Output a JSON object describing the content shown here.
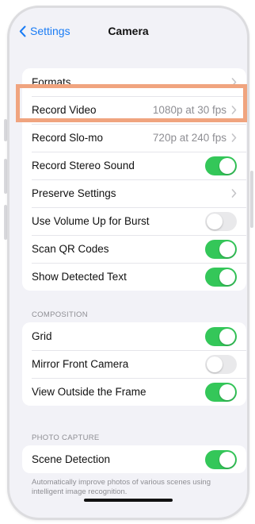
{
  "nav": {
    "back_label": "Settings",
    "title": "Camera"
  },
  "group1": {
    "rows": [
      {
        "label": "Formats",
        "value": ""
      },
      {
        "label": "Record Video",
        "value": "1080p at 30 fps"
      },
      {
        "label": "Record Slo-mo",
        "value": "720p at 240 fps"
      },
      {
        "label": "Record Stereo Sound",
        "toggle": "on"
      },
      {
        "label": "Preserve Settings",
        "value": ""
      },
      {
        "label": "Use Volume Up for Burst",
        "toggle": "off"
      },
      {
        "label": "Scan QR Codes",
        "toggle": "on"
      },
      {
        "label": "Show Detected Text",
        "toggle": "on"
      }
    ]
  },
  "composition": {
    "header": "COMPOSITION",
    "rows": [
      {
        "label": "Grid",
        "toggle": "on"
      },
      {
        "label": "Mirror Front Camera",
        "toggle": "off"
      },
      {
        "label": "View Outside the Frame",
        "toggle": "on"
      }
    ]
  },
  "photo_capture": {
    "header": "PHOTO CAPTURE",
    "rows": [
      {
        "label": "Scene Detection",
        "toggle": "on"
      }
    ],
    "footer": "Automatically improve photos of various scenes using intelligent image recognition."
  },
  "colors": {
    "accent": "#1a7cf5",
    "toggle_on": "#34c759",
    "highlight": "#f0a47f"
  }
}
